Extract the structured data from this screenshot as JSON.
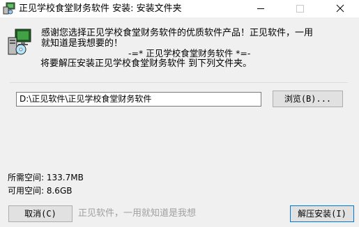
{
  "window": {
    "title": "正见学校食堂财务软件 安装: 安装文件夹"
  },
  "message": {
    "line1": "感谢您选择正见学校食堂财务软件的优质软件产品！正见软件，一用",
    "line2": "就知道是我想要的！",
    "line3": "-=*  正见学校食堂财务软件  *=-",
    "line4": "将要解压安装正见学校食堂财务软件 到下列文件夹。"
  },
  "install_path": {
    "value": "D:\\正见软件\\正见学校食堂财务软件"
  },
  "buttons": {
    "browse": "浏览(B)...",
    "cancel": "取消(C)",
    "extract": "解压安装(I)"
  },
  "space": {
    "required": "所需空间: 133.7MB",
    "available": "可用空间: 8.6GB"
  },
  "footer": {
    "brand": "正见软件，一用就知道是我想"
  },
  "icons": {
    "app": "installer-computer-icon",
    "title": "installer-icon"
  }
}
